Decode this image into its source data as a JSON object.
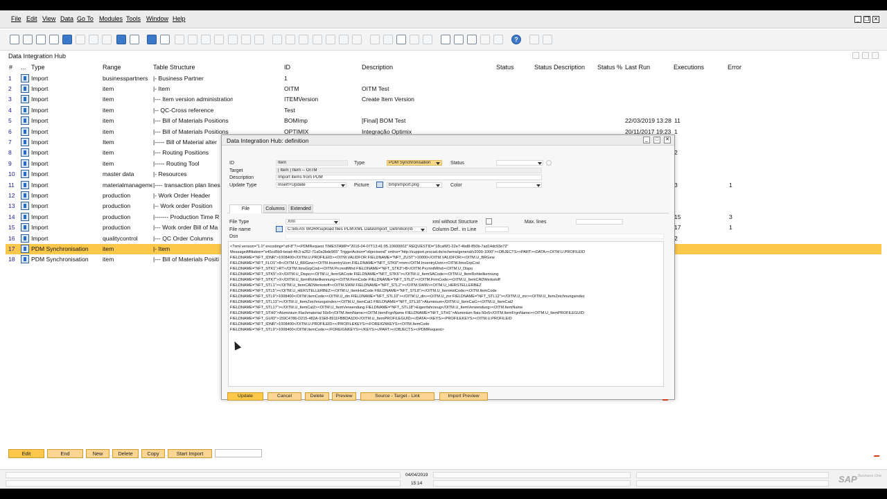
{
  "menu": {
    "items": [
      "File",
      "Edit",
      "View",
      "Data",
      "Go To",
      "Modules",
      "Tools",
      "Window",
      "Help"
    ]
  },
  "main_window": {
    "title": "Data Integration Hub"
  },
  "grid": {
    "columns": [
      "#",
      "...",
      "Type",
      "Range",
      "Table Structure",
      "ID",
      "Description",
      "Status",
      "Status Description",
      "Status %",
      "Last Run",
      "Executions",
      "Error"
    ],
    "rows": [
      {
        "num": "1",
        "type": "Import",
        "range": "businesspartners",
        "struct": "|- Business Partner",
        "id": "1",
        "desc": "",
        "lastrun": "",
        "exec": "",
        "err": ""
      },
      {
        "num": "2",
        "type": "Import",
        "range": "item",
        "struct": "|- Item",
        "id": "OITM",
        "desc": "OITM Test",
        "lastrun": "",
        "exec": "",
        "err": ""
      },
      {
        "num": "3",
        "type": "Import",
        "range": "item",
        "struct": "|--- Item version administration",
        "id": "ITEMVersion",
        "desc": "Create Item Version",
        "lastrun": "",
        "exec": "",
        "err": ""
      },
      {
        "num": "4",
        "type": "Import",
        "range": "item",
        "struct": "|-- QC-Cross reference",
        "id": "Test",
        "desc": "",
        "lastrun": "",
        "exec": "",
        "err": ""
      },
      {
        "num": "5",
        "type": "Import",
        "range": "item",
        "struct": "|--- Bill of Materials Positions",
        "id": "BOMImp",
        "desc": "[Final] BOM Test",
        "lastrun": "22/03/2019 13:28",
        "exec": "11",
        "err": ""
      },
      {
        "num": "6",
        "type": "Import",
        "range": "item",
        "struct": "|--- Bill of Materials Positions",
        "id": "OPTIMIX",
        "desc": "Integração Optimix",
        "lastrun": "20/11/2017 19:23",
        "exec": "1",
        "err": ""
      },
      {
        "num": "7",
        "type": "Import",
        "range": "Item",
        "struct": "|----- Bill of Material alter",
        "id": "",
        "desc": "",
        "lastrun": "",
        "exec": "",
        "err": ""
      },
      {
        "num": "8",
        "type": "Import",
        "range": "item",
        "struct": "|--- Routing Positions",
        "id": "",
        "desc": "",
        "lastrun": "",
        "exec": "2",
        "err": ""
      },
      {
        "num": "9",
        "type": "Import",
        "range": "item",
        "struct": "|----- Routing Tool",
        "id": "",
        "desc": "",
        "lastrun": "",
        "exec": "",
        "err": ""
      },
      {
        "num": "10",
        "type": "Import",
        "range": "master data",
        "struct": "|- Resources",
        "id": "",
        "desc": "",
        "lastrun": "",
        "exec": "",
        "err": ""
      },
      {
        "num": "11",
        "type": "Import",
        "range": "materialmanageme",
        "struct": "|---- transaction plan lines",
        "id": "",
        "desc": "",
        "lastrun": "",
        "exec": "3",
        "err": "1"
      },
      {
        "num": "12",
        "type": "Import",
        "range": "production",
        "struct": "|- Work Order  Header",
        "id": "",
        "desc": "",
        "lastrun": "",
        "exec": "",
        "err": ""
      },
      {
        "num": "13",
        "type": "Import",
        "range": "production",
        "struct": "|-- Work order Position",
        "id": "",
        "desc": "",
        "lastrun": "",
        "exec": "",
        "err": ""
      },
      {
        "num": "14",
        "type": "Import",
        "range": "production",
        "struct": "|------- Production Time R",
        "id": "",
        "desc": "",
        "lastrun": "",
        "exec": "15",
        "err": "3"
      },
      {
        "num": "15",
        "type": "Import",
        "range": "production",
        "struct": "|--- Work order Bill of Ma",
        "id": "",
        "desc": "",
        "lastrun": "",
        "exec": "17",
        "err": "1"
      },
      {
        "num": "16",
        "type": "Import",
        "range": "qualitycontrol",
        "struct": "|--- QC Order Columns",
        "id": "",
        "desc": "",
        "lastrun": "",
        "exec": "2",
        "err": ""
      },
      {
        "num": "17",
        "type": "PDM Synchronisation",
        "range": "item",
        "struct": "|- Item",
        "id": "",
        "desc": "",
        "lastrun": "",
        "exec": "",
        "err": ""
      },
      {
        "num": "18",
        "type": "PDM Synchronisation",
        "range": "item",
        "struct": "|--- Bill of Materials Positi",
        "id": "",
        "desc": "",
        "lastrun": "",
        "exec": "",
        "err": ""
      }
    ]
  },
  "dialog": {
    "title": "Data Integration Hub: definition",
    "labels": {
      "id": "ID",
      "type": "Type",
      "status": "Status",
      "target": "Target",
      "description": "Description",
      "update_type": "Update Type",
      "picture": "Picture",
      "color": "Color",
      "file_type": "File Type",
      "xml_without_structure": "xml without Structure",
      "max_lines": "Max. lines",
      "file_name": "File name",
      "column_def_in_line": "Column Def.. in Line",
      "dsn": "Dsn"
    },
    "values": {
      "id": "Item",
      "type": "PDM Synchronisation",
      "target": "| Item | Item -- OITM",
      "description": "Import items from PDM",
      "update_type": "Insert+Update",
      "picture": "bmp\\import.png",
      "file_type": "Xml",
      "file_name": "C:\\BEAS WORK\\upload files PLM\\XML Data\\Import_Definition)\\b"
    },
    "tabs": [
      "File",
      "Columns",
      "Extended"
    ],
    "xml_lines": [
      "<?xml version=\"1.0\" encoding=\"utf-8\"?><PDMRequest TIMESTAMP=\"2016-04-07T13:41:05.1060000Z\" REQUESTID=\"18caf6f1-22e7-4bd8-850b-7ad14dc93e72\"",
      "MessageAffiliation=\"e45cd5b9-bead-4fc3-a252-71a0a3bde965\" TriggerAction=\"objectsend\" xmlns=\"http://support.procad.de/schema/general/v2000-1000\"><OBJECTS><PART><DATA><OITM.U.PROFILEID",
      "FIELDNAME=\"NFT_IDNR\">1008400</OITM.U.PROFILEID><OITM.VALIDFOR FIELDNAME=\"NFT_ZUST\">10000</OITM.VALIDFOR><OITM.U_BRGew",
      "FIELDNAME=\"NFT_FLO1\">8</OITM.U_BRGew><OITM.InventryUom FIELDNAME=\"NFT_STK0\">mm</OITM.InventryUom><OITM.ItmsGrpCod",
      "FIELDNAME=\"NFT_STK1\">RT</OITM.ItmsGrpCod><OITM.PrcmntMthd FIELDNAME=\"NFT_STK3\">B</OITM.PrcmntMthd><OITM.U_Dispo",
      "FIELDNAME=\"NFT_STK5\">X</OITM.U_Dispo><OITM.U_ItemSACode FIELDNAME=\"NFT_STK6\"></OITM.U_ItemSACode><OITM.U_ItemRohteilkennung",
      "FIELDNAME=\"NFT_STK7\">X</OITM.U_ItemRohteilkennung><OITM.FirmCode FIELDNAME=\"NFT_STL0\"></OITM.FirmCode><OITM.U_ItemCADWerkstoff",
      "FIELDNAME=\"NFT_STL1\"></OITM.U_ItemCADWerkstoff><OITM.SWW FIELDNAME=\"NFT_STL2\"></OITM.SWW><OITM.U_HERSTELLERBEZ",
      "FIELDNAME=\"NFT_STL5\"></OITM.U_HERSTELLERBEZ><OITM.U_ItemHstCode FIELDNAME=\"NFT_STL8\"></OITM.U_ItemHstCode><OITM.ItemCode",
      "FIELDNAME=\"NFT_STL9\">1008400</OITM.ItemCode><OITM.U_din FIELDNAME=\"NFT_STL10\"></OITM.U_din><OITM.U_znr FIELDNAME=\"NFT_STL12\"></OITM.U_znr><OITM.U_ItemZeichnungsindex",
      "FIELDNAME=\"NFT_STL13\"></OITM.U_ItemZeichnungsindex><OITM.U_ItemCat1 FIELDNAME=\"NFT_STL16\">Aluminium</OITM.U_ItemCat1><OITM.U_ItemCat2",
      "FIELDNAME=\"NFT_STL17\"></OITM.U_ItemCat2><OITM.U_ItemVerwendung FIELDNAME=\"NFT_STL18\">Eigenfahrzeug</OITM.U_ItemVerwendung><OITM.ItemName",
      "FIELDNAME=\"NFT_STH0\">Aluminium Flachmaterial 50x5</OITM.ItemName><OITM.ItemFrgnName FIELDNAME=\"NFT_STH1\">Aluminium flats 50x5</OITM.ItemFrgnName><OITM.U_ItemPROFILEGUID",
      "FIELDNAME=\"NFT_GUID\">159C4786-D215-482A-91E8-8911FBBDA1D0</OITM.U_ItemPROFILEGUID></DATA><KEYS><PROFILEKEYS><OITM.U.PROFILEID",
      "FIELDNAME=\"NFT_IDNR\">1008400</OITM.U.PROFILEID></PROFILEKEYS><FOREIGNKEYS><OITM.ItemCode",
      "FIELDNAME=\"NFT_STL9\">1008400</OITM.ItemCode></FOREIGNKEYS></KEYS></PART></OBJECTS></PDMRequest>"
    ],
    "buttons": [
      "Update",
      "Cancel",
      "Delete",
      "Preview",
      "Source - Target - Link",
      "Import Preview"
    ]
  },
  "bottom_buttons": [
    "Edit",
    "End",
    "New",
    "Delete",
    "Copy",
    "Start Import"
  ],
  "status_bar": {
    "date": "04/04/2019",
    "time": "15:14",
    "logo_text": "SAP",
    "logo_sub": "Business One"
  },
  "colors": {
    "accent": "#fcc84c",
    "selected_row": "#fcc84c",
    "link_number": "#1a1a9a"
  }
}
